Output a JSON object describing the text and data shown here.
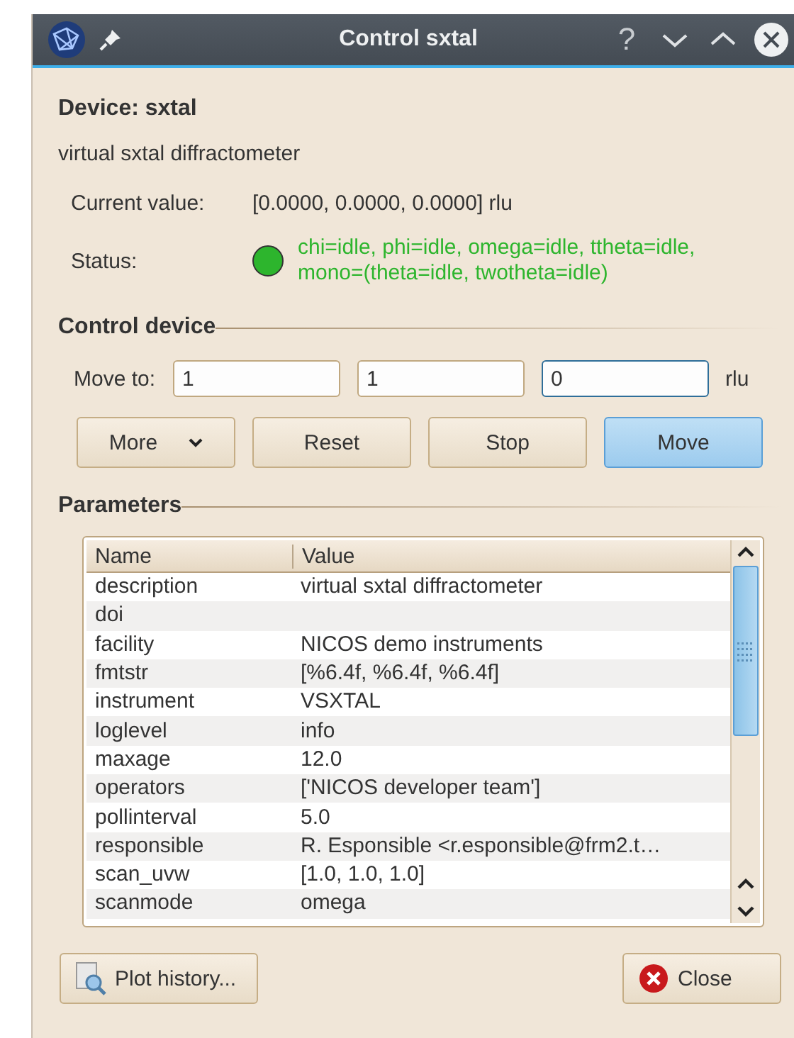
{
  "window": {
    "title": "Control sxtal",
    "controls": [
      "?"
    ]
  },
  "device": {
    "title": "Device: sxtal",
    "description": "virtual sxtal diffractometer"
  },
  "current_value": {
    "label": "Current value:",
    "value": "[0.0000, 0.0000, 0.0000] rlu"
  },
  "status": {
    "label": "Status:",
    "color": "#2db52d",
    "text": "chi=idle, phi=idle, omega=idle, ttheta=idle, mono=(theta=idle, twotheta=idle)"
  },
  "control": {
    "title": "Control device",
    "move_label": "Move to:",
    "unit": "rlu",
    "inputs": [
      {
        "value": "1",
        "focused": false
      },
      {
        "value": "1",
        "focused": false
      },
      {
        "value": "0",
        "focused": true
      }
    ],
    "buttons": [
      {
        "label": "More",
        "kind": "menu",
        "default": false
      },
      {
        "label": "Reset",
        "kind": "plain",
        "default": false
      },
      {
        "label": "Stop",
        "kind": "plain",
        "default": false
      },
      {
        "label": "Move",
        "kind": "plain",
        "default": true
      }
    ]
  },
  "parameters": {
    "title": "Parameters",
    "columns": [
      "Name",
      "Value"
    ],
    "rows": [
      [
        "description",
        "virtual sxtal diffractometer"
      ],
      [
        "doi",
        ""
      ],
      [
        "facility",
        "NICOS demo instruments"
      ],
      [
        "fmtstr",
        "[%6.4f, %6.4f, %6.4f]"
      ],
      [
        "instrument",
        "VSXTAL"
      ],
      [
        "loglevel",
        "info"
      ],
      [
        "maxage",
        "12.0"
      ],
      [
        "operators",
        "['NICOS developer team']"
      ],
      [
        "pollinterval",
        "5.0"
      ],
      [
        "responsible",
        "R. Esponsible <r.esponsible@frm2.t…"
      ],
      [
        "scan_uvw",
        "[1.0, 1.0, 1.0]"
      ],
      [
        "scanmode",
        "omega"
      ]
    ]
  },
  "footer": {
    "plot_button": "Plot history...",
    "close_button": "Close"
  }
}
